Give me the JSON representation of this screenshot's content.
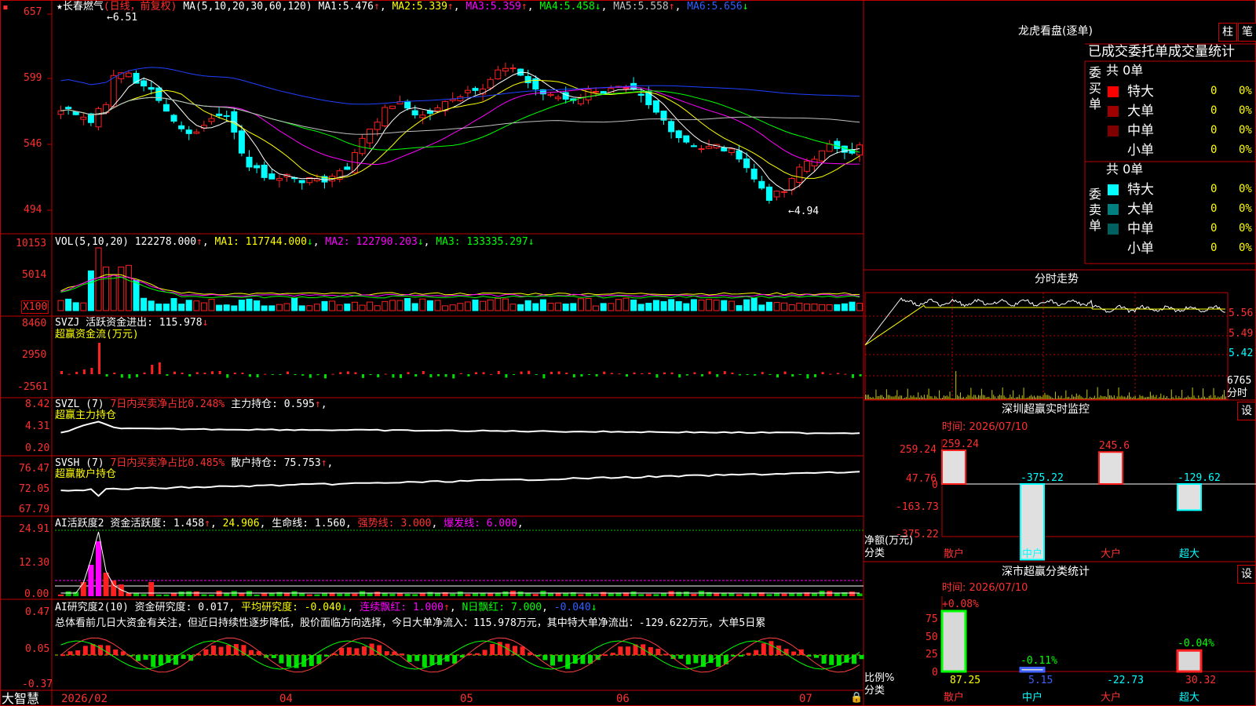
{
  "colors": {
    "up": "#ff2020",
    "down": "#00ffff",
    "ma1": "#ffffff",
    "ma2": "#ffff00",
    "ma3": "#ff00ff",
    "ma4": "#00ff00",
    "ma5": "#c0c0c0",
    "ma6": "#2040ff",
    "grid": "#c00000"
  },
  "chart": {
    "title": "长春燃气",
    "cycle": "(日线，前复权)",
    "ma_label": "MA(5,10,20,30,60,120)",
    "ma": [
      {
        "k": "MA1:",
        "v": "5.476"
      },
      {
        "k": "MA2:",
        "v": "5.339"
      },
      {
        "k": "MA3:",
        "v": "5.359"
      },
      {
        "k": "MA4:",
        "v": "5.458"
      },
      {
        "k": "MA5:",
        "v": "5.558"
      },
      {
        "k": "MA6:",
        "v": "5.656"
      }
    ],
    "y_labels": [
      "657",
      "599",
      "546",
      "494"
    ],
    "high_marker": "6.51",
    "low_marker": "4.94"
  },
  "vol": {
    "label": "VOL(5,10,20)",
    "val": "122278.000",
    "ma1": "MA1: 117744.000",
    "ma2": "MA2: 122790.203",
    "ma3": "MA3: 133335.297",
    "y_labels": [
      "10153",
      "5014"
    ],
    "unit": "X100"
  },
  "svzj": {
    "label": "SVZJ",
    "sub": "活跃资金进出: 115.978",
    "title": "超赢资金流(万元)",
    "y_labels": [
      "8460",
      "2950",
      "-2561"
    ]
  },
  "svzl": {
    "label": "SVZL (7)",
    "sub1": "7日内买卖净占比0.248%",
    "sub2": "主力持仓: 0.595",
    "title": "超赢主力持仓",
    "y_labels": [
      "8.42",
      "4.31",
      "0.20"
    ]
  },
  "svsh": {
    "label": "SVSH (7)",
    "sub1": "7日内买卖净占比0.485%",
    "sub2": "散户持仓: 75.753",
    "title": "超赢散户持仓",
    "y_labels": [
      "76.47",
      "72.05",
      "67.79"
    ]
  },
  "ai1": {
    "label": "AI活跃度2",
    "s1": "资金活跃度: 1.458",
    "s2": "24.906",
    "s3": "生命线: 1.560",
    "s4": "强势线: 3.000",
    "s5": "爆发线: 6.000",
    "y_labels": [
      "24.91",
      "12.30",
      "0.00"
    ]
  },
  "ai2": {
    "label": "AI研究度2(10)",
    "s1": "资金研究度: 0.017",
    "s2": "平均研究度: -0.040",
    "s3": "连续飘红: 1.000",
    "s4": "N日飘红: 7.000",
    "s5": "-0.040",
    "y_labels": [
      "0.47",
      "0.05",
      "-0.37"
    ],
    "summary": "总体看前几日大资金有关注，但近日持续性逐步降低，股价面临方向选择，今日大单净流入：115.978万元，其中特大单净流出：-129.622万元，大单5日累"
  },
  "x_axis": {
    "brand": "大智慧",
    "labels": [
      "2026/02",
      "04",
      "05",
      "06",
      "07"
    ]
  },
  "lhb": {
    "title": "龙虎看盘(逐单)",
    "tab1": "柱",
    "tab2": "笔",
    "header": "已成交委托单成交量统计",
    "buy_side": "委买单",
    "sell_side": "委卖单",
    "total_buy": "共 0单",
    "total_sell": "共 0单",
    "rows": [
      {
        "name": "特大",
        "n": "0",
        "p": "0%"
      },
      {
        "name": "大单",
        "n": "0",
        "p": "0%"
      },
      {
        "name": "中单",
        "n": "0",
        "p": "0%"
      },
      {
        "name": "小单",
        "n": "0",
        "p": "0%"
      }
    ]
  },
  "minute": {
    "title": "分时走势",
    "p1": "5.56",
    "p2": "5.49",
    "p3": "5.42",
    "vol": "6765",
    "vol_label": "分时"
  },
  "szmon": {
    "title": "深圳超赢实时监控",
    "set": "设",
    "time": "时间: 2026/07/10",
    "y_labels": [
      "259.24",
      "47.76",
      "0",
      "-163.73",
      "-375.22"
    ],
    "bars": [
      {
        "cat": "散户",
        "v": 259.24,
        "label": "259.24"
      },
      {
        "cat": "中户",
        "v": -375.22,
        "label": "-375.22"
      },
      {
        "cat": "大户",
        "v": 245.6,
        "label": "245.6"
      },
      {
        "cat": "超大",
        "v": -129.62,
        "label": "-129.62"
      }
    ],
    "ylabel": "净额(万元)",
    "xlabel": "分类"
  },
  "szcls": {
    "title": "深市超赢分类统计",
    "set": "设",
    "time": "时间: 2026/07/10",
    "y_labels": [
      "75",
      "50",
      "25",
      "0"
    ],
    "bars": [
      {
        "cat": "散户",
        "v": 87.25,
        "chg": "+0.08%"
      },
      {
        "cat": "中户",
        "v": 5.15,
        "chg": "-0.11%"
      },
      {
        "cat": "大户",
        "v": -22.73,
        "chg": ""
      },
      {
        "cat": "超大",
        "v": 30.32,
        "chg": "-0.04%"
      }
    ],
    "ylabel": "比例%",
    "xlabel": "分类"
  }
}
